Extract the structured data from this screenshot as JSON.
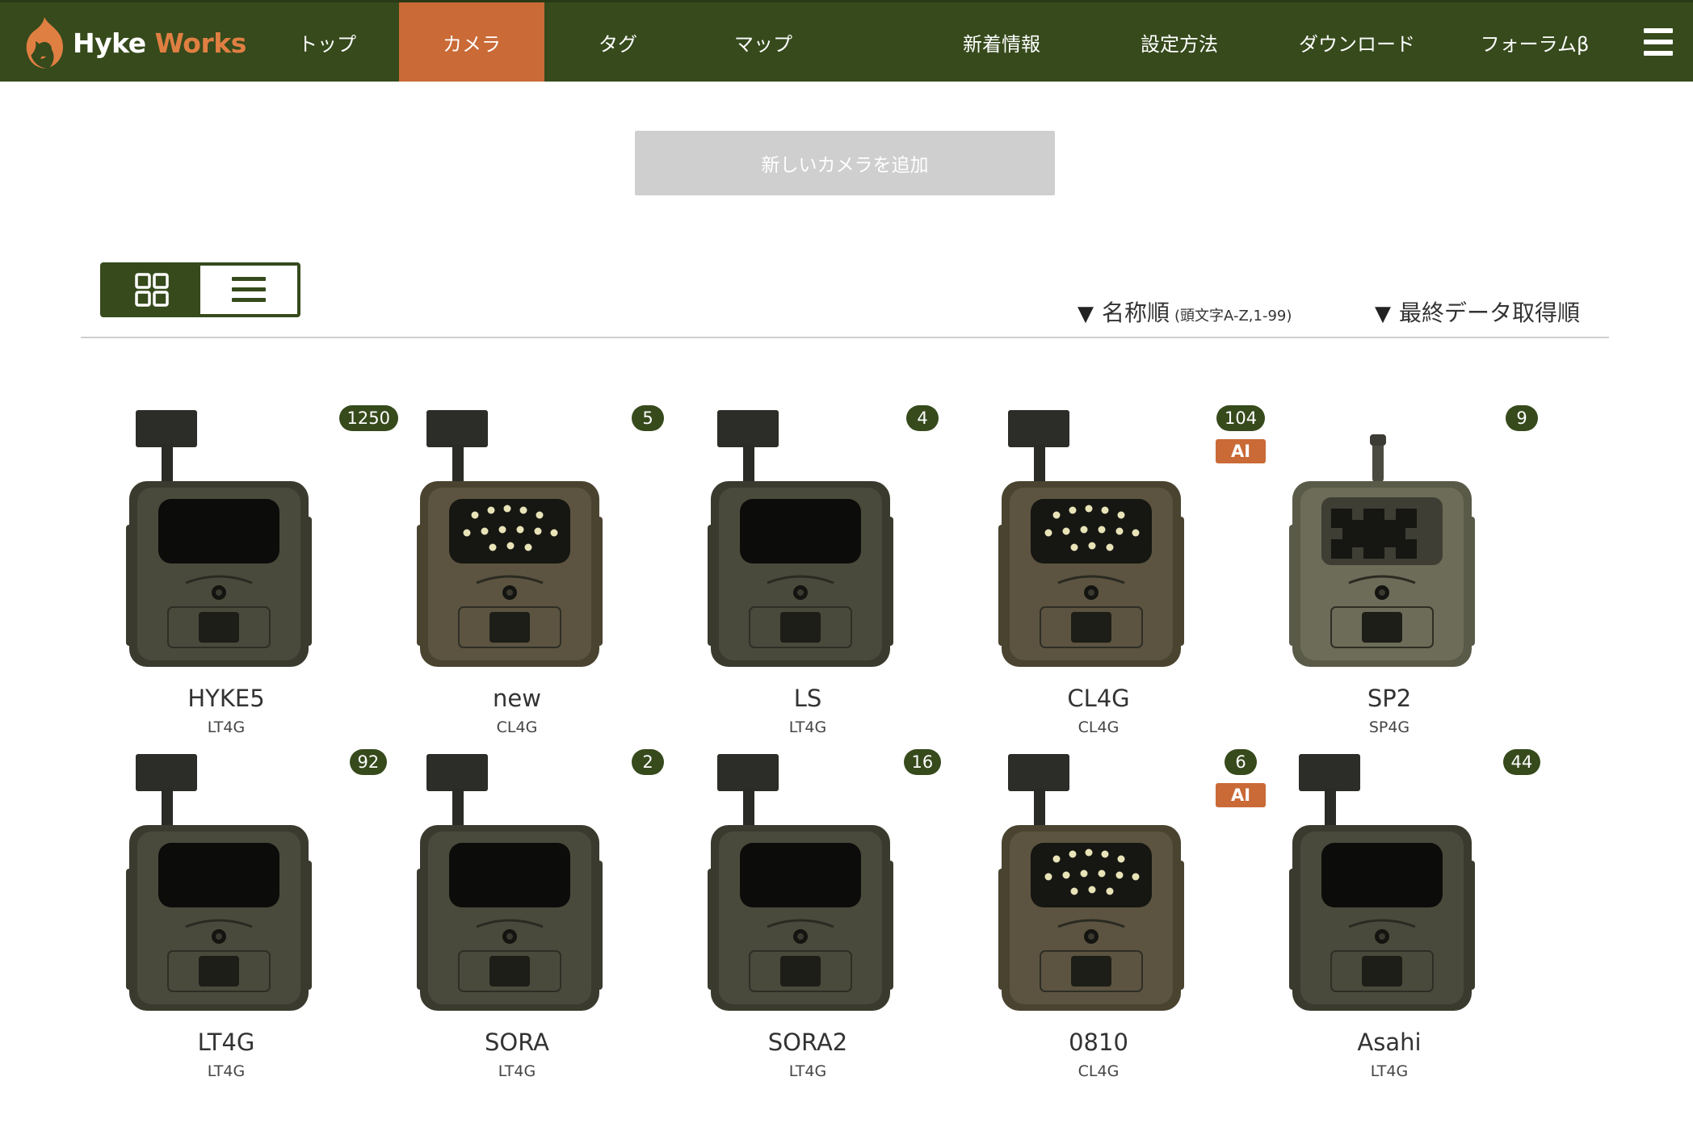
{
  "header": {
    "logo_hyke": "Hyke",
    "logo_works": "Works",
    "nav": [
      {
        "label": "トップ"
      },
      {
        "label": "カメラ"
      },
      {
        "label": "タグ"
      },
      {
        "label": "マップ"
      },
      {
        "label": "新着情報"
      },
      {
        "label": "設定方法"
      },
      {
        "label": "ダウンロード"
      },
      {
        "label": "フォーラムβ"
      }
    ],
    "active_nav": "カメラ",
    "menu_icon": "hamburger-icon"
  },
  "actions": {
    "add_camera_label": "新しいカメラを追加"
  },
  "view_toggle": {
    "selected": "grid",
    "grid_icon": "grid-view-icon",
    "list_icon": "list-view-icon"
  },
  "sort": {
    "by_name_label": "名称順",
    "by_name_sub": "(頭文字A-Z,1-99)",
    "by_last_data_label": "最終データ取得順",
    "arrow": "▼"
  },
  "cameras": [
    {
      "name": "HYKE5",
      "model": "LT4G",
      "count": "1250",
      "ai": "",
      "type": "plain"
    },
    {
      "name": "new",
      "model": "CL4G",
      "count": "5",
      "ai": "",
      "type": "led"
    },
    {
      "name": "LS",
      "model": "LT4G",
      "count": "4",
      "ai": "",
      "type": "plain"
    },
    {
      "name": "CL4G",
      "model": "CL4G",
      "count": "104",
      "ai": "AI",
      "type": "led"
    },
    {
      "name": "SP2",
      "model": "SP4G",
      "count": "9",
      "ai": "",
      "type": "sp"
    },
    {
      "name": "LT4G",
      "model": "LT4G",
      "count": "92",
      "ai": "",
      "type": "plain"
    },
    {
      "name": "SORA",
      "model": "LT4G",
      "count": "2",
      "ai": "",
      "type": "plain"
    },
    {
      "name": "SORA2",
      "model": "LT4G",
      "count": "16",
      "ai": "",
      "type": "plain"
    },
    {
      "name": "0810",
      "model": "CL4G",
      "count": "6",
      "ai": "AI",
      "type": "led"
    },
    {
      "name": "Asahi",
      "model": "LT4G",
      "count": "44",
      "ai": "",
      "type": "plain"
    }
  ],
  "colors": {
    "header_bg": "#364a1c",
    "accent_orange": "#c96a37",
    "badge_bg": "#364a1c",
    "button_disabled": "#cfcfcf"
  }
}
